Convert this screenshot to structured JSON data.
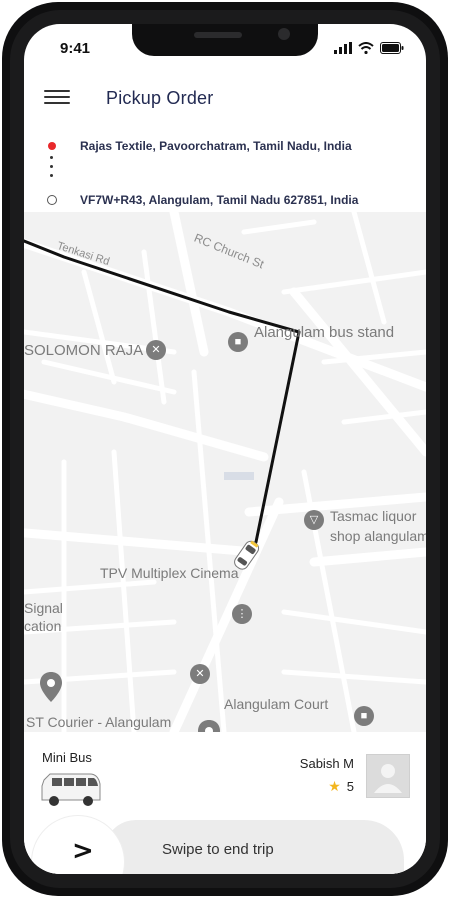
{
  "status": {
    "time": "9:41"
  },
  "header": {
    "title": "Pickup Order",
    "menu_icon": "hamburger-menu-icon"
  },
  "route": {
    "pickup": "Rajas Textile, Pavoorchatram, Tamil Nadu, India",
    "dropoff": "VF7W+R43, Alangulam, Tamil Nadu 627851, India"
  },
  "map": {
    "labels": {
      "tenkasi_rd": "Tenkasi Rd",
      "rc_church": "RC Church St",
      "bus_stand": "Alangulam bus stand",
      "solomon": "SOLOMON RAJA",
      "tasmac_1": "Tasmac liquor",
      "tasmac_2": "shop alangulam",
      "tpv": "TPV Multiplex Cinema",
      "signal_1": "Signal",
      "signal_2": "cation",
      "st_courier": "ST Courier - Alangulam",
      "court": "Alangulam Court"
    },
    "route_color": "#111111"
  },
  "trip": {
    "vehicle_type": "Mini Bus",
    "driver_name": "Sabish M",
    "rating": "5",
    "swipe_label": "Swipe to end trip",
    "swipe_arrow": ">"
  },
  "colors": {
    "accent_red": "#e8282b",
    "title": "#222a52",
    "star": "#f3b61f"
  }
}
